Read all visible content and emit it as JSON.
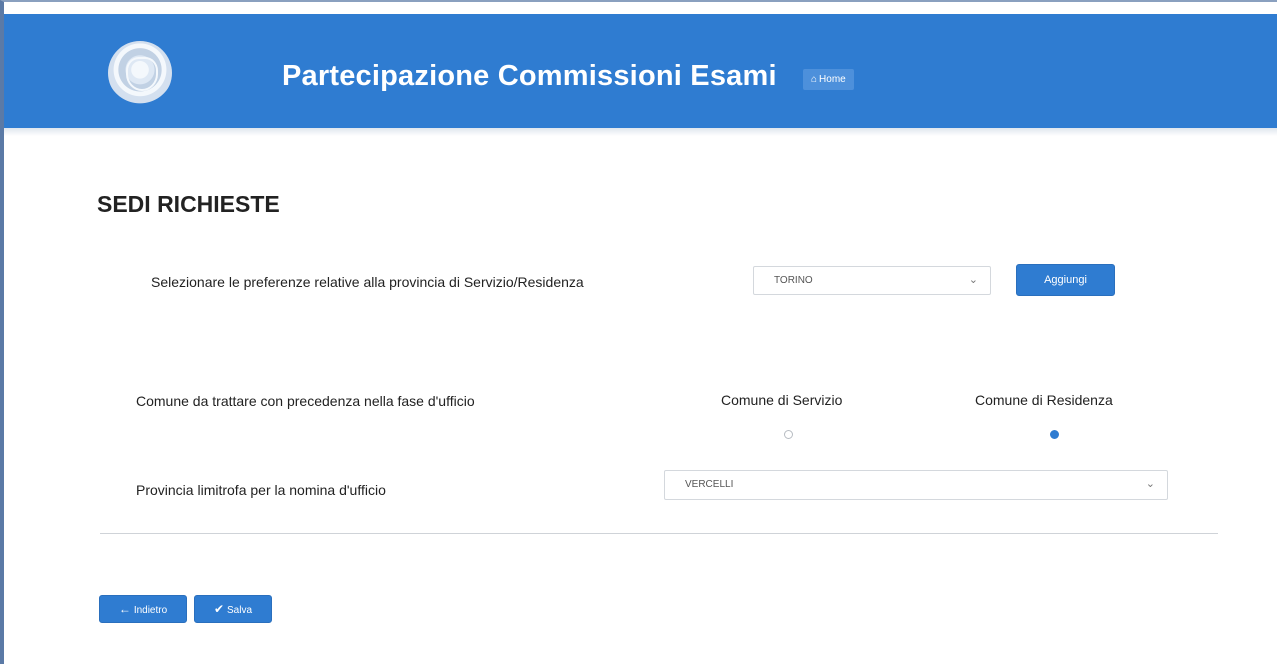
{
  "header": {
    "title": "Partecipazione Commissioni Esami",
    "home_label": "Home",
    "home_icon": "home-icon",
    "logo": "emblem-logo"
  },
  "section": {
    "title": "SEDI RICHIESTE"
  },
  "province_preference": {
    "label": "Selezionare le preferenze relative alla provincia di Servizio/Residenza",
    "selected": "TORINO",
    "button_label": "Aggiungi"
  },
  "priority": {
    "label": "Comune da trattare con precedenza nella fase d'ufficio",
    "options": [
      {
        "label": "Comune di Servizio",
        "checked": false
      },
      {
        "label": "Comune di Residenza",
        "checked": true
      }
    ]
  },
  "neighbor_province": {
    "label": "Provincia limitrofa per la nomina d'ufficio",
    "selected": "VERCELLI"
  },
  "nav": {
    "back_label": "Indietro",
    "back_icon": "arrow-left-icon",
    "save_label": "Salva",
    "save_icon": "check-icon"
  },
  "colors": {
    "primary": "#2f7cd1",
    "header_bg": "#2f7cd1"
  }
}
